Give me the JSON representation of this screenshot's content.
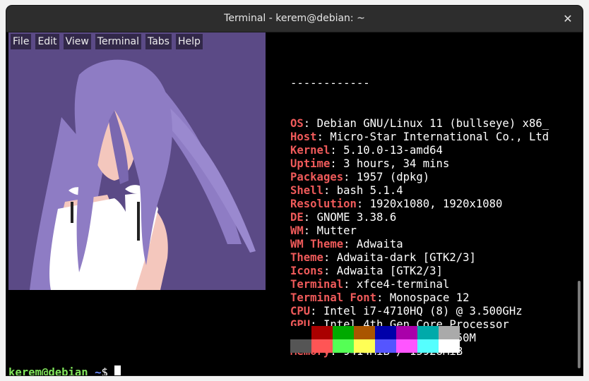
{
  "window": {
    "title": "Terminal - kerem@debian: ~"
  },
  "menubar": {
    "items": [
      "File",
      "Edit",
      "View",
      "Terminal",
      "Tabs",
      "Help"
    ]
  },
  "neofetch": {
    "separator": "------------",
    "rows": [
      {
        "key": "OS",
        "value": "Debian GNU/Linux 11 (bullseye) x86_"
      },
      {
        "key": "Host",
        "value": "Micro-Star International Co., Ltd"
      },
      {
        "key": "Kernel",
        "value": "5.10.0-13-amd64"
      },
      {
        "key": "Uptime",
        "value": "3 hours, 34 mins"
      },
      {
        "key": "Packages",
        "value": "1957 (dpkg)"
      },
      {
        "key": "Shell",
        "value": "bash 5.1.4"
      },
      {
        "key": "Resolution",
        "value": "1920x1080, 1920x1080"
      },
      {
        "key": "DE",
        "value": "GNOME 3.38.6"
      },
      {
        "key": "WM",
        "value": "Mutter"
      },
      {
        "key": "WM Theme",
        "value": "Adwaita"
      },
      {
        "key": "Theme",
        "value": "Adwaita-dark [GTK2/3]"
      },
      {
        "key": "Icons",
        "value": "Adwaita [GTK2/3]"
      },
      {
        "key": "Terminal",
        "value": "xfce4-terminal"
      },
      {
        "key": "Terminal Font",
        "value": "Monospace 12"
      },
      {
        "key": "CPU",
        "value": "Intel i7-4710HQ (8) @ 3.500GHz"
      },
      {
        "key": "GPU",
        "value": "Intel 4th Gen Core Processor"
      },
      {
        "key": "GPU",
        "value": "NVIDIA GeForce GTX 850M"
      },
      {
        "key": "Memory",
        "value": "9414MiB / 15928MiB"
      }
    ],
    "palette": {
      "row1": [
        "#000000",
        "#aa0000",
        "#00aa00",
        "#aa5500",
        "#0000aa",
        "#aa00aa",
        "#00aaaa",
        "#aaaaaa"
      ],
      "row2": [
        "#555555",
        "#ff5555",
        "#55ff55",
        "#ffff55",
        "#5555ff",
        "#ff55ff",
        "#55ffff",
        "#ffffff"
      ]
    }
  },
  "prompt": {
    "user_host": "kerem@debian",
    "colon": ":",
    "path": "~",
    "symbol": "$ "
  },
  "colors": {
    "key": "#ef5a5a",
    "prompt_user": "#7fe35a",
    "prompt_path": "#6a8bff",
    "wallpaper_bg": "#5b4a86"
  },
  "icons": {
    "close": "close-icon"
  }
}
